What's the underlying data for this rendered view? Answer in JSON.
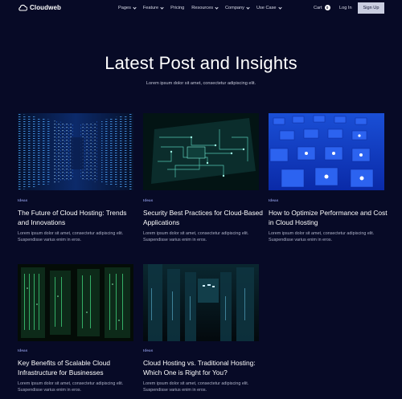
{
  "brand": {
    "name": "Cloudweb",
    "icon": "cloud-icon"
  },
  "nav": {
    "items": [
      {
        "label": "Pages",
        "has_dropdown": true
      },
      {
        "label": "Feature",
        "has_dropdown": true
      },
      {
        "label": "Pricing",
        "has_dropdown": false
      },
      {
        "label": "Resources",
        "has_dropdown": true
      },
      {
        "label": "Company",
        "has_dropdown": true
      },
      {
        "label": "Use Case",
        "has_dropdown": true
      }
    ],
    "cart_label": "Cart",
    "cart_count": "0",
    "login_label": "Log In",
    "signup_label": "Sign Up"
  },
  "hero": {
    "title": "Latest Post and Insights",
    "subtitle": "Lorem ipsum dolor sit amet, consectetur adipiscing elit."
  },
  "posts": [
    {
      "category": "Ideas",
      "title": "The Future of Cloud Hosting: Trends and Innovations",
      "excerpt": "Lorem ipsum dolor sit amet, consectetur adipiscing elit. Suspendisse varius enim in eros.",
      "image": "server-racks-blue-lights"
    },
    {
      "category": "Ideas",
      "title": "Security Best Practices for Cloud-Based Applications",
      "excerpt": "Lorem ipsum dolor sit amet, consectetur adipiscing elit. Suspendisse varius enim in eros.",
      "image": "circuit-board-teal"
    },
    {
      "category": "Ideas",
      "title": "How to Optimize Performance and Cost in Cloud Hosting",
      "excerpt": "Lorem ipsum dolor sit amet, consectetur adipiscing elit. Suspendisse varius enim in eros.",
      "image": "blue-cubes"
    },
    {
      "category": "Ideas",
      "title": "Key Benefits of Scalable Cloud Infrastructure for Businesses",
      "excerpt": "Lorem ipsum dolor sit amet, consectetur adipiscing elit. Suspendisse varius enim in eros.",
      "image": "server-racks-green"
    },
    {
      "category": "Ideas",
      "title": "Cloud Hosting vs. Traditional Hosting: Which One is Right for You?",
      "excerpt": "Lorem ipsum dolor sit amet, consectetur adipiscing elit. Suspendisse varius enim in eros.",
      "image": "data-center-dark"
    }
  ],
  "colors": {
    "background": "#070a26",
    "category": "#7b86c9",
    "button": "#c9cde0"
  }
}
